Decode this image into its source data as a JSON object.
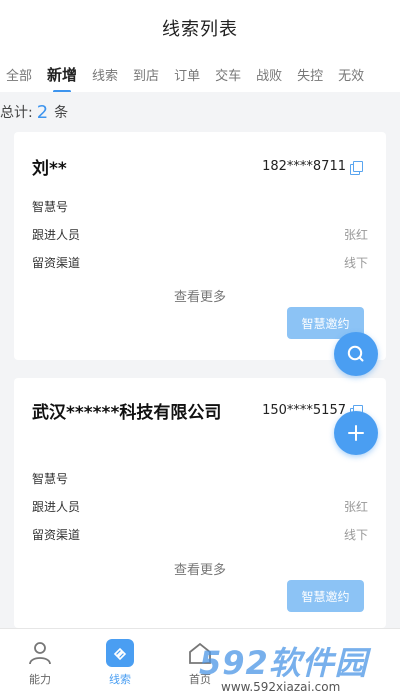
{
  "header": {
    "title": "线索列表"
  },
  "tabs": [
    {
      "label": "全部",
      "active": false
    },
    {
      "label": "新增",
      "active": true
    },
    {
      "label": "线索",
      "active": false
    },
    {
      "label": "到店",
      "active": false
    },
    {
      "label": "订单",
      "active": false
    },
    {
      "label": "交车",
      "active": false
    },
    {
      "label": "战败",
      "active": false
    },
    {
      "label": "失控",
      "active": false
    },
    {
      "label": "无效",
      "active": false
    }
  ],
  "summary": {
    "prefix": "总计:",
    "count": "2",
    "unit": "条"
  },
  "cards": [
    {
      "name": "刘**",
      "phone": "182****8711",
      "rows": [
        {
          "label": "智慧号",
          "value": ""
        },
        {
          "label": "跟进人员",
          "value": "张红"
        },
        {
          "label": "留资渠道",
          "value": "线下"
        }
      ],
      "more_label": "查看更多",
      "invite_label": "智慧邀约"
    },
    {
      "name": "武汉******科技有限公司",
      "phone": "150****5157",
      "rows": [
        {
          "label": "智慧号",
          "value": ""
        },
        {
          "label": "跟进人员",
          "value": "张红"
        },
        {
          "label": "留资渠道",
          "value": "线下"
        }
      ],
      "more_label": "查看更多",
      "invite_label": "智慧邀约"
    }
  ],
  "fabs": {
    "search_icon": "search-icon",
    "add_icon": "plus-icon"
  },
  "bottom_nav": [
    {
      "label": "能力",
      "icon": "person-icon",
      "active": false
    },
    {
      "label": "线索",
      "icon": "lead-icon",
      "active": true
    },
    {
      "label": "首页",
      "icon": "home-icon",
      "active": false
    },
    {
      "label": "",
      "icon": "",
      "active": false
    },
    {
      "label": "",
      "icon": "",
      "active": false
    }
  ],
  "watermark": {
    "logo": "592软件园",
    "url": "www.592xiazai.com"
  },
  "colors": {
    "accent": "#4a9ef2",
    "invite": "#8cc3f5",
    "active_tab_bar": "#3d94ee"
  }
}
